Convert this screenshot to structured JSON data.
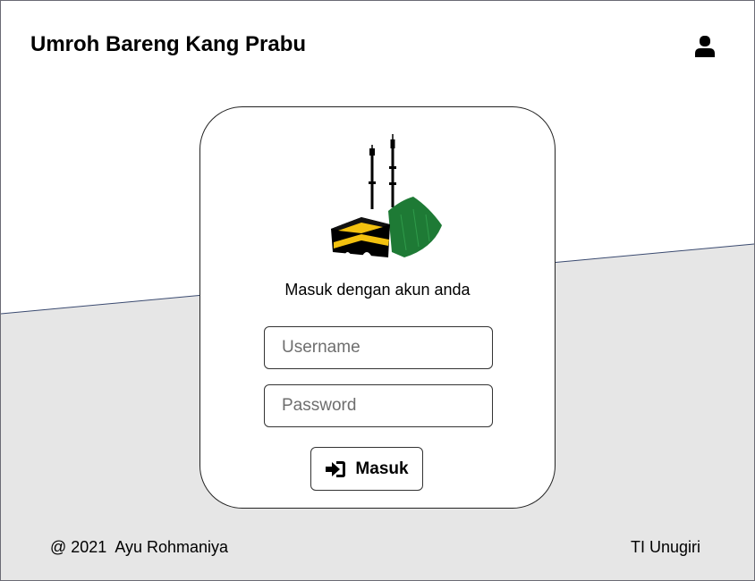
{
  "header": {
    "app_title": "Umroh Bareng Kang Prabu",
    "user_icon": "user-icon"
  },
  "login": {
    "logo_icon": "kaaba-mosque-logo",
    "prompt": "Masuk dengan akun anda",
    "username_placeholder": "Username",
    "username_value": "",
    "password_placeholder": "Password",
    "password_value": "",
    "submit_icon": "sign-in-icon",
    "submit_label": "Masuk"
  },
  "footer": {
    "copyright": "@ 2021  Ayu Rohmaniya",
    "institution": "TI Unugiri"
  },
  "colors": {
    "background_top": "#ffffff",
    "background_bottom": "#e6e6e6",
    "divider_line": "#3a4a70",
    "dome_green": "#1e7a35",
    "kaaba_gold": "#f2c10f"
  }
}
